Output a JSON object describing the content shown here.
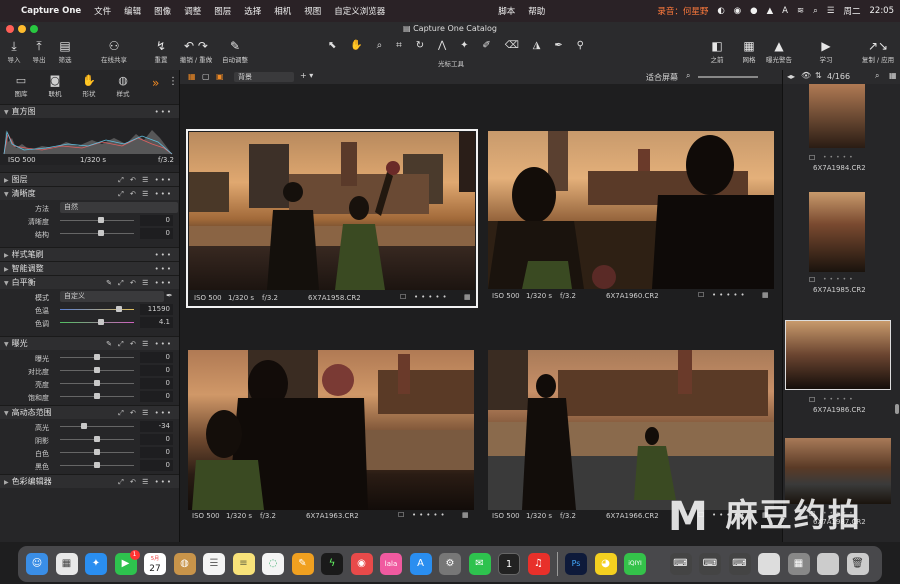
{
  "menubar": {
    "apple": "",
    "app": "Capture One",
    "items": [
      "文件",
      "编辑",
      "图像",
      "调整",
      "图层",
      "选择",
      "相机",
      "视图",
      "自定义浏览器",
      "脚本",
      "帮助"
    ],
    "recording": "录音：何星野",
    "date": "周二",
    "time": "22:05"
  },
  "window": {
    "title": "Capture One Catalog"
  },
  "toolbar": {
    "left": [
      {
        "icon": "import-icon",
        "glyph": "⤓",
        "label": "导入"
      },
      {
        "icon": "export-icon",
        "glyph": "⤒",
        "label": "导出"
      },
      {
        "icon": "filter-icon",
        "glyph": "▤",
        "label": "筛选"
      },
      {
        "icon": "share-icon",
        "glyph": "⚇",
        "label": "在线共享"
      },
      {
        "icon": "reset-icon",
        "glyph": "↯",
        "label": "重置"
      },
      {
        "icon": "undo-redo-icon",
        "glyph": "↶ ↷",
        "label": "撤销 / 重做"
      },
      {
        "icon": "auto-adjust-icon",
        "glyph": "✎",
        "label": "自动调整"
      }
    ],
    "cursor_label": "光标工具",
    "right": [
      {
        "icon": "before-icon",
        "glyph": "◧",
        "label": "之前"
      },
      {
        "icon": "grid-icon",
        "glyph": "▦",
        "label": "网格"
      },
      {
        "icon": "exposure-warning-icon",
        "glyph": "▲",
        "label": "曝光警告"
      },
      {
        "icon": "learn-icon",
        "glyph": "▶",
        "label": "学习"
      },
      {
        "icon": "copy-apply-icon",
        "glyph": "↗↘",
        "label": "复制 / 应用"
      }
    ]
  },
  "left_panel": {
    "tool_tabs": [
      "图库",
      "联机",
      "形状",
      "样式"
    ],
    "histogram": {
      "title": "直方图",
      "iso": "ISO 500",
      "shutter": "1/320 s",
      "aperture": "f/3.2"
    },
    "sections": {
      "layers": "图层",
      "clarity": {
        "title": "清晰度",
        "method_label": "方法",
        "method_value": "自然",
        "clarity_label": "清晰度",
        "clarity_value": "0",
        "structure_label": "结构",
        "structure_value": "0"
      },
      "style_brush": "样式笔刷",
      "smart_adjust": "智能调整",
      "white_balance": {
        "title": "白平衡",
        "mode_label": "模式",
        "mode_value": "自定义",
        "temp_label": "色温",
        "temp_value": "11590",
        "tint_label": "色调",
        "tint_value": "4.1"
      },
      "exposure": {
        "title": "曝光",
        "rows": [
          {
            "label": "曝光",
            "value": "0",
            "pos": 0.5
          },
          {
            "label": "对比度",
            "value": "0",
            "pos": 0.5
          },
          {
            "label": "亮度",
            "value": "0",
            "pos": 0.5
          },
          {
            "label": "饱和度",
            "value": "0",
            "pos": 0.5
          }
        ]
      },
      "hdr": {
        "title": "高动态范围",
        "rows": [
          {
            "label": "高光",
            "value": "-34",
            "pos": 0.33
          },
          {
            "label": "阴影",
            "value": "0",
            "pos": 0.5
          },
          {
            "label": "白色",
            "value": "0",
            "pos": 0.5
          },
          {
            "label": "黑色",
            "value": "0",
            "pos": 0.5
          }
        ]
      },
      "color_editor": "色彩编辑器"
    }
  },
  "viewer_bar": {
    "background": "背景",
    "fit": "适合屏幕",
    "counter": "4/166"
  },
  "viewer": {
    "images": [
      {
        "iso": "ISO 500",
        "shutter": "1/320 s",
        "aperture": "f/3.2",
        "name": "6X7A1958.CR2",
        "selected": true
      },
      {
        "iso": "ISO 500",
        "shutter": "1/320 s",
        "aperture": "f/3.2",
        "name": "6X7A1960.CR2",
        "selected": false
      },
      {
        "iso": "ISO 500",
        "shutter": "1/320 s",
        "aperture": "f/3.2",
        "name": "6X7A1963.CR2",
        "selected": false
      },
      {
        "iso": "ISO 500",
        "shutter": "1/320 s",
        "aperture": "f/3.2",
        "name": "6X7A1966.CR2",
        "selected": false
      }
    ]
  },
  "filmstrip": [
    "6X7A1984.CR2",
    "6X7A1985.CR2",
    "6X7A1986.CR2",
    "6X7A1987.CR2"
  ],
  "watermark": {
    "letter": "M",
    "text": "麻豆约拍"
  },
  "dock": {
    "calendar_month": "5月",
    "calendar_day": "27",
    "facetime_badge": "1"
  }
}
